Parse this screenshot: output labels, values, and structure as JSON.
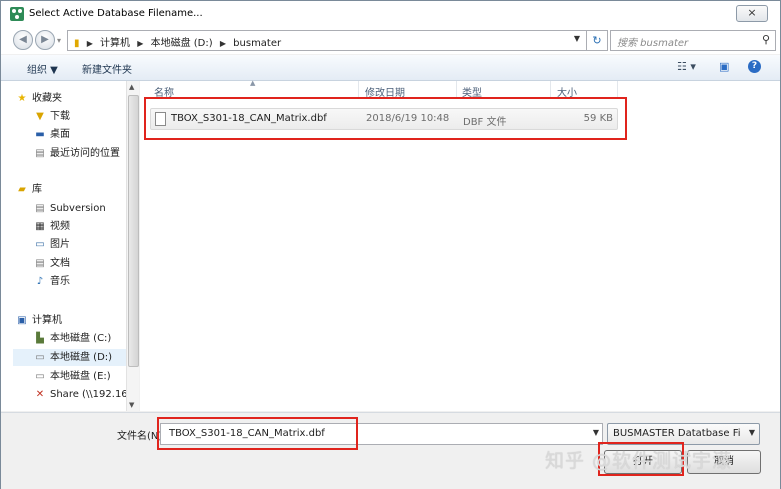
{
  "window": {
    "title": "Select Active Database Filename...",
    "close_label": "×"
  },
  "address": {
    "crumbs": [
      "计算机",
      "本地磁盘 (D:)",
      "busmater"
    ],
    "search_placeholder": "搜索 busmater"
  },
  "toolbar": {
    "organize_label": "组织 ▼",
    "new_folder_label": "新建文件夹"
  },
  "nav": {
    "items": [
      {
        "label": "收藏夹",
        "icon": "star-icon"
      },
      {
        "label": "下载",
        "icon": "download-folder-icon"
      },
      {
        "label": "桌面",
        "icon": "desktop-icon"
      },
      {
        "label": "最近访问的位置",
        "icon": "recent-places-icon"
      },
      {
        "label": "库",
        "icon": "library-icon"
      },
      {
        "label": "Subversion",
        "icon": "document-icon"
      },
      {
        "label": "视频",
        "icon": "video-icon"
      },
      {
        "label": "图片",
        "icon": "picture-icon"
      },
      {
        "label": "文档",
        "icon": "document-icon"
      },
      {
        "label": "音乐",
        "icon": "music-icon"
      },
      {
        "label": "计算机",
        "icon": "computer-icon"
      },
      {
        "label": "本地磁盘 (C:)",
        "icon": "system-drive-icon"
      },
      {
        "label": "本地磁盘 (D:)",
        "icon": "drive-icon"
      },
      {
        "label": "本地磁盘 (E:)",
        "icon": "drive-icon"
      },
      {
        "label": "Share (\\\\192.16",
        "icon": "network-drive-icon"
      }
    ]
  },
  "columns": {
    "name": "名称",
    "date": "修改日期",
    "type": "类型",
    "size": "大小"
  },
  "files": [
    {
      "name": "TBOX_S301-18_CAN_Matrix.dbf",
      "date": "2018/6/19 10:48",
      "type": "DBF 文件",
      "size": "59 KB"
    }
  ],
  "footer": {
    "filename_label": "文件名(N):",
    "filename_value": "TBOX_S301-18_CAN_Matrix.dbf",
    "filetype_value": "BUSMASTER Datatbase File(",
    "open_label": "打开",
    "cancel_label": "取消"
  },
  "watermark": "知乎 @软件测试宇濛",
  "colors": {
    "highlight": "#e0241d",
    "selection": "#e5f1fb"
  }
}
